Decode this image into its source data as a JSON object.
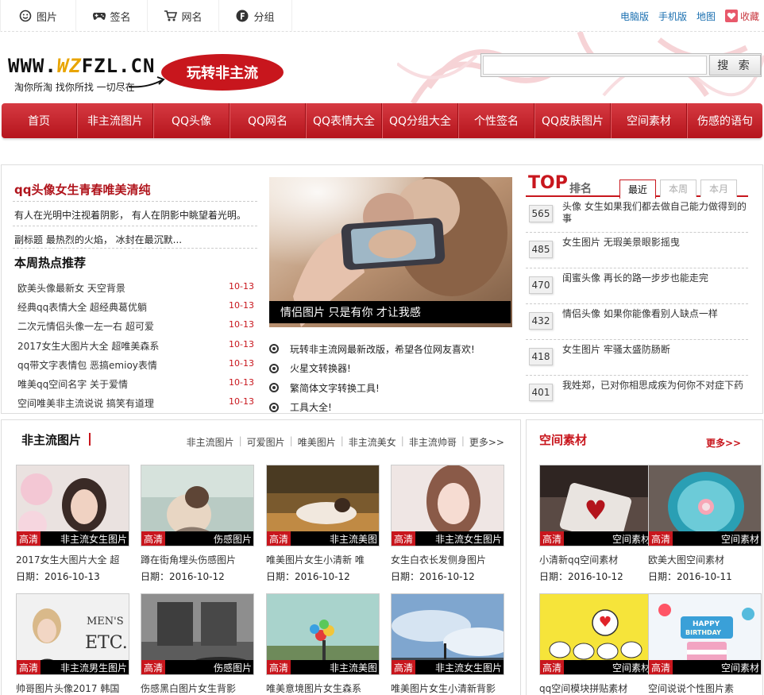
{
  "topnav": [
    {
      "label": "图片",
      "icon": "smiley-icon"
    },
    {
      "label": "签名",
      "icon": "gamepad-icon"
    },
    {
      "label": "网名",
      "icon": "cart-icon"
    },
    {
      "label": "分组",
      "icon": "f-icon"
    }
  ],
  "toplinks": {
    "pc": "电脑版",
    "mobile": "手机版",
    "map": "地图",
    "fav": "收藏"
  },
  "logo": {
    "url_pre": "WWW.",
    "url_wz": "WZ",
    "url_post": "FZL.CN",
    "slogan": "淘你所淘 找你所找 一切尽在",
    "bubble": "玩转非主流"
  },
  "search": {
    "placeholder": "",
    "button": "搜 索"
  },
  "mainnav": [
    "首页",
    "非主流图片",
    "QQ头像",
    "QQ网名",
    "QQ表情大全",
    "QQ分组大全",
    "个性签名",
    "QQ皮肤图片",
    "空间素材",
    "伤感的语句"
  ],
  "sec1": {
    "headline": "qq头像女生青春唯美清纯",
    "para1": "有人在光明中注视着阴影， 有人在阴影中眺望着光明。",
    "para2": "副标题 最热烈的火焰， 冰封在最沉默...",
    "hot_title": "本周热点推荐",
    "hot": [
      {
        "t": "欧美头像最新女 天空背景",
        "d": "10-13"
      },
      {
        "t": "经典qq表情大全 超经典葛优躺",
        "d": "10-13"
      },
      {
        "t": "二次元情侣头像一左一右 超可爱",
        "d": "10-13"
      },
      {
        "t": "2017女生大图片大全 超唯美森系",
        "d": "10-13"
      },
      {
        "t": "qq带文字表情包 恶搞emioy表情",
        "d": "10-13"
      },
      {
        "t": "唯美qq空间名字 关于爱情",
        "d": "10-13"
      },
      {
        "t": "空间唯美非主流说说 搞笑有道理",
        "d": "10-13"
      }
    ],
    "photo_caption": "情侣图片 只是有你 才让我感",
    "news": [
      "玩转非主流网最新改版，希望各位网友喜欢!",
      "火星文转换器!",
      "繁简体文字转换工具!",
      "工具大全!"
    ],
    "top_big": "TOP",
    "top_sm": "排名",
    "tabs": [
      "最近",
      "本周",
      "本月"
    ],
    "ranks": [
      {
        "n": "565",
        "t": "头像 女生如果我们都去做自己能力做得到的事"
      },
      {
        "n": "485",
        "t": "女生图片 无瑕美景眼影摇曳"
      },
      {
        "n": "470",
        "t": "闺蜜头像 再长的路一步步也能走完"
      },
      {
        "n": "432",
        "t": "情侣头像 如果你能像看别人缺点一样"
      },
      {
        "n": "418",
        "t": "女生图片 牢骚太盛防肠断"
      },
      {
        "n": "401",
        "t": "我姓郑，已对你相思成疾为何你不对症下药"
      }
    ]
  },
  "sec2": {
    "title": "非主流图片",
    "tags": [
      "非主流图片",
      "可爱图片",
      "唯美图片",
      "非主流美女",
      "非主流帅哥"
    ],
    "more": "更多>>",
    "cards": [
      {
        "cat": "非主流女生图片",
        "t": "2017女生大图片大全 超",
        "d": "日期：2016-10-13"
      },
      {
        "cat": "伤感图片",
        "t": "蹲在街角埋头伤感图片",
        "d": "日期：2016-10-12"
      },
      {
        "cat": "非主流美图",
        "t": "唯美图片女生小清新 唯",
        "d": "日期：2016-10-12"
      },
      {
        "cat": "非主流女生图片",
        "t": "女生白衣长发侧身图片",
        "d": "日期：2016-10-12"
      },
      {
        "cat": "非主流男生图片",
        "t": "帅哥图片头像2017 韩国",
        "d": ""
      },
      {
        "cat": "伤感图片",
        "t": "伤感黑白图片女生背影",
        "d": ""
      },
      {
        "cat": "非主流美图",
        "t": "唯美意境图片女生森系",
        "d": ""
      },
      {
        "cat": "非主流女生图片",
        "t": "唯美图片女生小清新背影",
        "d": ""
      }
    ]
  },
  "sec3": {
    "title": "空间素材",
    "more": "更多>>",
    "cards": [
      {
        "cat": "空间素材",
        "t": "小清新qq空间素材",
        "d": "日期：2016-10-12"
      },
      {
        "cat": "空间素材",
        "t": "欧美大图空间素材",
        "d": "日期：2016-10-11"
      },
      {
        "cat": "空间素材",
        "t": "qq空间模块拼贴素材",
        "d": ""
      },
      {
        "cat": "空间素材",
        "t": "空间说说个性图片素",
        "d": ""
      }
    ]
  },
  "badge_hq": "高清",
  "thumb_texts": {
    "mens": "MEN'S",
    "etc": "ETC.",
    "happy": "HAPPY",
    "birthday": "BIRTHDAY"
  },
  "colors": {
    "brand": "#c8161d",
    "link": "#1a6fb0"
  }
}
